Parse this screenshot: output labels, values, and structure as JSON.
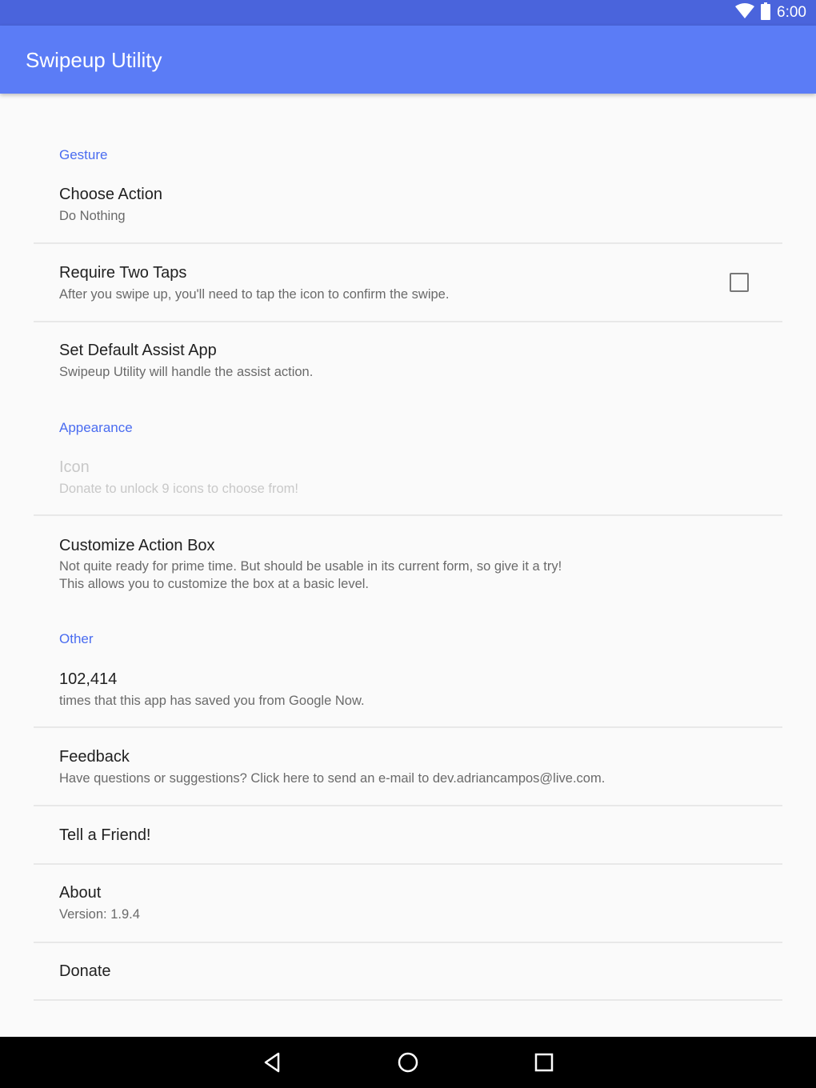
{
  "status_bar": {
    "time": "6:00",
    "icons": [
      "wifi-icon",
      "battery-icon"
    ],
    "color": "#4a64dc"
  },
  "app_bar": {
    "title": "Swipeup Utility",
    "color": "#5b7cf6"
  },
  "accent_color": "#4a6cf0",
  "sections": {
    "gesture": {
      "header": "Gesture",
      "choose_action": {
        "title": "Choose Action",
        "summary": "Do Nothing"
      },
      "require_two_taps": {
        "title": "Require Two Taps",
        "summary": "After you swipe up, you'll need to tap the icon to confirm the swipe.",
        "checked": false
      },
      "default_assist": {
        "title": "Set Default Assist App",
        "summary": "Swipeup Utility will handle the assist action."
      }
    },
    "appearance": {
      "header": "Appearance",
      "icon": {
        "title": "Icon",
        "summary": "Donate to unlock 9 icons to choose from!",
        "enabled": false
      },
      "customize_box": {
        "title": "Customize Action Box",
        "summary_line1": "Not quite ready for prime time. But should be usable in its current form, so give it a try!",
        "summary_line2": "This allows you to customize the box at a basic level."
      }
    },
    "other": {
      "header": "Other",
      "counter": {
        "title": "102,414",
        "summary": "times that this app has saved you from Google Now."
      },
      "feedback": {
        "title": "Feedback",
        "summary": "Have questions or suggestions? Click here to send an e-mail to dev.adriancampos@live.com."
      },
      "tell_friend": {
        "title": "Tell a Friend!"
      },
      "about": {
        "title": "About",
        "summary": "Version: 1.9.4"
      },
      "donate": {
        "title": "Donate"
      }
    }
  },
  "nav_bar": {
    "buttons": [
      "back-icon",
      "home-icon",
      "recents-icon"
    ]
  }
}
